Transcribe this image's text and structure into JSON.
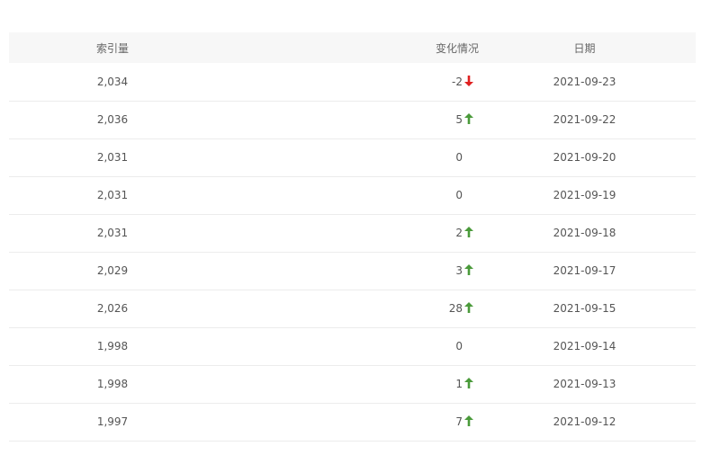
{
  "table": {
    "headers": {
      "index": "索引量",
      "change": "变化情况",
      "date": "日期"
    },
    "colors": {
      "up": "#4a9a3a",
      "down": "#e02020"
    },
    "rows": [
      {
        "index": "2,034",
        "change": "-2",
        "direction": "down",
        "date": "2021-09-23"
      },
      {
        "index": "2,036",
        "change": "5",
        "direction": "up",
        "date": "2021-09-22"
      },
      {
        "index": "2,031",
        "change": "0",
        "direction": "none",
        "date": "2021-09-20"
      },
      {
        "index": "2,031",
        "change": "0",
        "direction": "none",
        "date": "2021-09-19"
      },
      {
        "index": "2,031",
        "change": "2",
        "direction": "up",
        "date": "2021-09-18"
      },
      {
        "index": "2,029",
        "change": "3",
        "direction": "up",
        "date": "2021-09-17"
      },
      {
        "index": "2,026",
        "change": "28",
        "direction": "up",
        "date": "2021-09-15"
      },
      {
        "index": "1,998",
        "change": "0",
        "direction": "none",
        "date": "2021-09-14"
      },
      {
        "index": "1,998",
        "change": "1",
        "direction": "up",
        "date": "2021-09-13"
      },
      {
        "index": "1,997",
        "change": "7",
        "direction": "up",
        "date": "2021-09-12"
      }
    ]
  }
}
